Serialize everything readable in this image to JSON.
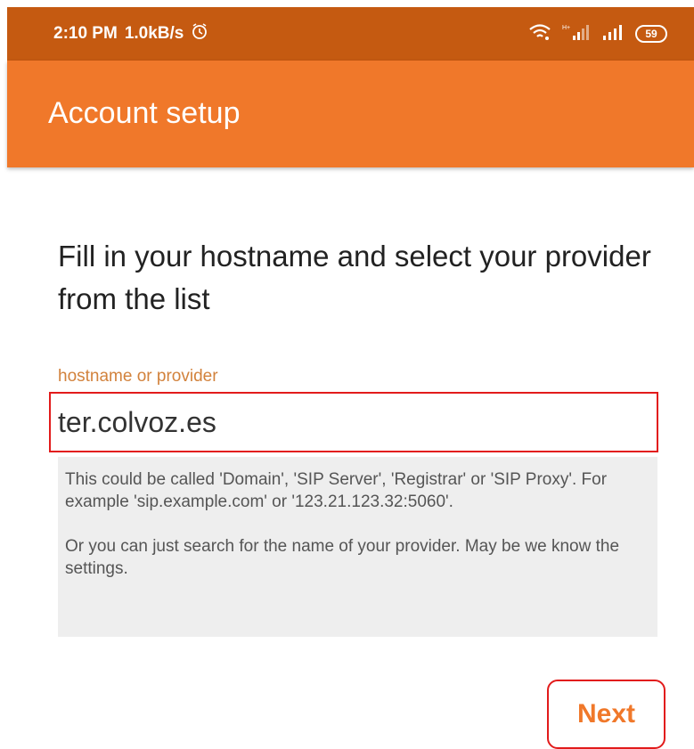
{
  "status_bar": {
    "time": "2:10 PM",
    "network_speed": "1.0kB/s",
    "battery_level": "59",
    "icons": [
      "alarm-icon",
      "wifi-icon",
      "signal-hplus-icon",
      "signal-icon",
      "battery-icon"
    ],
    "color": "#c55a11"
  },
  "app_bar": {
    "title": "Account setup",
    "color": "#f0782a"
  },
  "main": {
    "instruction": "Fill in your hostname and select your provider from the list",
    "hostname_label": "hostname or provider",
    "hostname_value": "ter.colvoz.es",
    "hint_paragraph_1": "This could be called 'Domain', 'SIP Server', 'Registrar' or 'SIP Proxy'. For example 'sip.example.com' or '123.21.123.32:5060'.",
    "hint_paragraph_2": "Or you can just search for the name of your provider. May be we know the settings."
  },
  "actions": {
    "next_label": "Next",
    "accent": "#f0782a"
  }
}
